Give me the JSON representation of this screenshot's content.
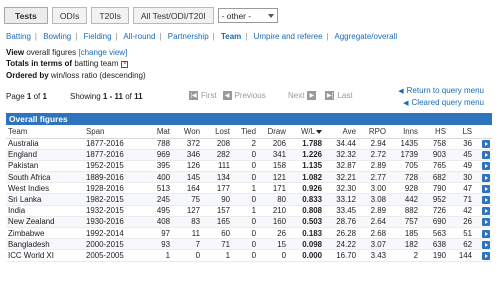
{
  "tabs": [
    {
      "label": "Tests",
      "active": true
    },
    {
      "label": "ODIs",
      "active": false
    },
    {
      "label": "T20Is",
      "active": false
    },
    {
      "label": "All Test/ODI/T20I",
      "active": false
    }
  ],
  "other_select": {
    "value": "- other -"
  },
  "subnav": [
    {
      "label": "Batting",
      "active": false
    },
    {
      "label": "Bowling",
      "active": false
    },
    {
      "label": "Fielding",
      "active": false
    },
    {
      "label": "All-round",
      "active": false
    },
    {
      "label": "Partnership",
      "active": false
    },
    {
      "label": "Team",
      "active": true
    },
    {
      "label": "Umpire and referee",
      "active": false
    },
    {
      "label": "Aggregate/overall",
      "active": false
    }
  ],
  "info": {
    "view_label": "View",
    "view_text": "overall figures",
    "change_view": "[change view]",
    "totals_label": "Totals in terms of",
    "totals_text": "batting team",
    "x_mark": "×",
    "ordered_label": "Ordered by",
    "ordered_text": "win/loss ratio (descending)"
  },
  "paging": {
    "page_word": "Page",
    "page_current": "1",
    "of_word": "of",
    "page_total": "1",
    "showing_word": "Showing",
    "showing_from": "1",
    "showing_dash": "-",
    "showing_to": "11",
    "showing_total": "11",
    "first": "First",
    "previous": "Previous",
    "next": "Next",
    "last": "Last",
    "return_link": "Return to query menu",
    "cleared_link": "Cleared query menu"
  },
  "table": {
    "title": "Overall figures",
    "columns": [
      "Team",
      "Span",
      "Mat",
      "Won",
      "Lost",
      "Tied",
      "Draw",
      "W/L",
      "Ave",
      "RPO",
      "Inns",
      "HS",
      "LS"
    ],
    "rows": [
      [
        "Australia",
        "1877-2016",
        "788",
        "372",
        "208",
        "2",
        "206",
        "1.788",
        "34.44",
        "2.94",
        "1435",
        "758",
        "36"
      ],
      [
        "England",
        "1877-2016",
        "969",
        "346",
        "282",
        "0",
        "341",
        "1.226",
        "32.32",
        "2.72",
        "1739",
        "903",
        "45"
      ],
      [
        "Pakistan",
        "1952-2015",
        "395",
        "126",
        "111",
        "0",
        "158",
        "1.135",
        "32.87",
        "2.89",
        "705",
        "765",
        "49"
      ],
      [
        "South Africa",
        "1889-2016",
        "400",
        "145",
        "134",
        "0",
        "121",
        "1.082",
        "32.21",
        "2.77",
        "728",
        "682",
        "30"
      ],
      [
        "West Indies",
        "1928-2016",
        "513",
        "164",
        "177",
        "1",
        "171",
        "0.926",
        "32.30",
        "3.00",
        "928",
        "790",
        "47"
      ],
      [
        "Sri Lanka",
        "1982-2015",
        "245",
        "75",
        "90",
        "0",
        "80",
        "0.833",
        "33.12",
        "3.08",
        "442",
        "952",
        "71"
      ],
      [
        "India",
        "1932-2015",
        "495",
        "127",
        "157",
        "1",
        "210",
        "0.808",
        "33.45",
        "2.89",
        "882",
        "726",
        "42"
      ],
      [
        "New Zealand",
        "1930-2016",
        "408",
        "83",
        "165",
        "0",
        "160",
        "0.503",
        "28.76",
        "2.64",
        "757",
        "690",
        "26"
      ],
      [
        "Zimbabwe",
        "1992-2014",
        "97",
        "11",
        "60",
        "0",
        "26",
        "0.183",
        "26.28",
        "2.68",
        "185",
        "563",
        "51"
      ],
      [
        "Bangladesh",
        "2000-2015",
        "93",
        "7",
        "71",
        "0",
        "15",
        "0.098",
        "24.22",
        "3.07",
        "182",
        "638",
        "62"
      ],
      [
        "ICC World XI",
        "2005-2005",
        "1",
        "0",
        "1",
        "0",
        "0",
        "0.000",
        "16.70",
        "3.43",
        "2",
        "190",
        "144"
      ]
    ]
  }
}
